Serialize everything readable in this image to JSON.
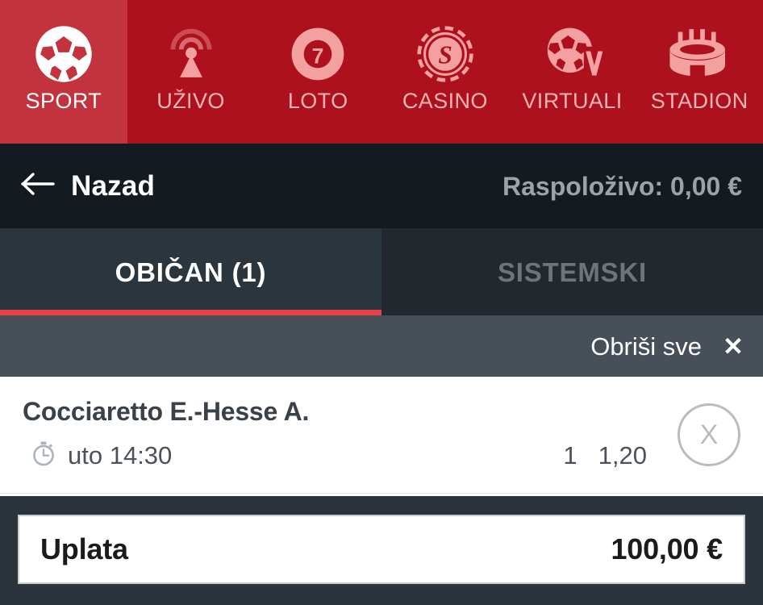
{
  "theme": {
    "brand_red": "#ae111e",
    "brand_red_active": "#c2333e",
    "accent_underline": "#e8404a",
    "dark_header": "#131a20",
    "tab_active_bg": "#2b353d",
    "tab_inactive_bg": "#22282d",
    "toolbar_bg": "#475059",
    "footer_bg": "#2b343c",
    "muted_text": "#9aa3a9"
  },
  "topnav": {
    "items": [
      {
        "label": "SPORT",
        "icon": "soccer-ball-icon",
        "active": true
      },
      {
        "label": "UŽIVO",
        "icon": "broadcast-icon",
        "active": false
      },
      {
        "label": "LOTO",
        "icon": "lotto-ball-7-icon",
        "active": false
      },
      {
        "label": "CASINO",
        "icon": "casino-chip-icon",
        "active": false
      },
      {
        "label": "VIRTUALI",
        "icon": "virtual-sport-icon",
        "active": false
      },
      {
        "label": "STADION",
        "icon": "stadium-icon",
        "active": false
      }
    ]
  },
  "header": {
    "back_label": "Nazad",
    "back_icon": "arrow-left-icon",
    "balance_text": "Raspoloživo: 0,00 €"
  },
  "tabs": [
    {
      "label": "OBIČAN (1)",
      "active": true
    },
    {
      "label": "SISTEMSKI",
      "active": false
    }
  ],
  "toolbar": {
    "clear_all_label": "Obriši sve",
    "clear_all_icon": "close-x-icon"
  },
  "bets": [
    {
      "title": "Cocciaretto E.-Hesse A.",
      "time_icon": "stopwatch-icon",
      "time_text": "uto 14:30",
      "pick": "1",
      "odds": "1,20",
      "remove_label": "X"
    }
  ],
  "footer": {
    "stake_label": "Uplata",
    "stake_value": "100,00 €"
  }
}
